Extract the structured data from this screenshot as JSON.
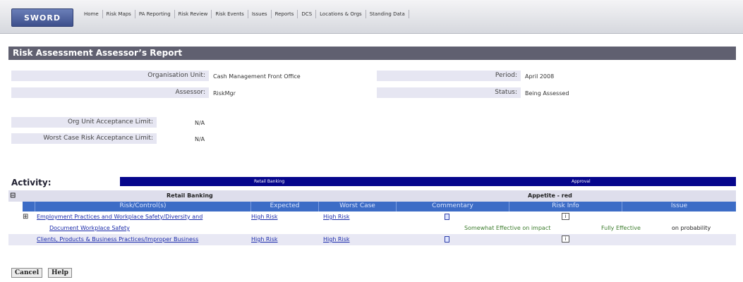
{
  "app": {
    "logo": "SWORD",
    "menu": [
      "Home",
      "Risk Maps",
      "PA Reporting",
      "Risk Review",
      "Risk Events",
      "Issues",
      "Reports",
      "DCS",
      "Locations & Orgs",
      "Standing Data"
    ]
  },
  "report": {
    "title": "Risk Assessment Assessor’s Report",
    "org_unit_label": "Organisation Unit:",
    "org_unit_value": "Cash Management Front Office",
    "assessor_label": "Assessor:",
    "assessor_value": "RiskMgr",
    "period_label": "Period:",
    "period_value": "April 2008",
    "status_label": "Status:",
    "status_value": "Being Assessed",
    "org_limit_label": "Org Unit Acceptance Limit:",
    "org_limit_value": "N/A",
    "worst_limit_label": "Worst Case Risk Acceptance Limit:",
    "worst_limit_value": "N/A"
  },
  "activity": {
    "label": "Activity:",
    "bar_left": "Retail Banking",
    "bar_right": "Approval"
  },
  "table": {
    "group_expander": "⊟",
    "group_name": "Retail Banking",
    "appetite": "Appetite - red",
    "headers": [
      "Risk/Control(s)",
      "Expected",
      "Worst Case",
      "Commentary",
      "Risk Info",
      "Issue"
    ],
    "rows": [
      {
        "expander": "⊞",
        "risk": "Employment Practices and Workplace Safety/Diversity and",
        "expected": "High Risk",
        "worst": "High Risk",
        "info": "i"
      },
      {
        "control": "Document Workplace Safety",
        "impact": "Somewhat Effective on impact",
        "effective": "Fully Effective",
        "probability": "on probability"
      },
      {
        "risk": "Clients, Products & Business Practices/Improper Business",
        "expected": "High Risk",
        "worst": "High Risk",
        "info": "i"
      }
    ]
  },
  "buttons": {
    "cancel": "Cancel",
    "help": "Help"
  },
  "colors": {
    "title_bar": "#606070",
    "activity_bar": "#06068c",
    "header_blue": "#3c6cc6",
    "link": "#1a2aaa"
  }
}
